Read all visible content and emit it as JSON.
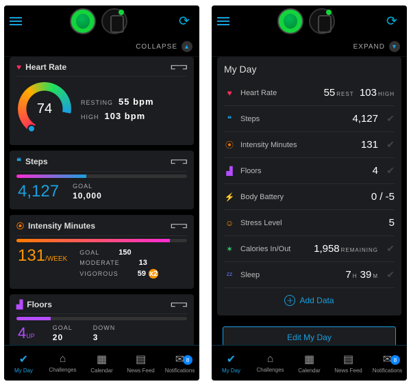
{
  "left": {
    "collapse_label": "COLLAPSE",
    "heart": {
      "title": "Heart Rate",
      "value": "74",
      "resting_label": "RESTING",
      "resting_value": "55 bpm",
      "high_label": "HIGH",
      "high_value": "103 bpm"
    },
    "steps": {
      "title": "Steps",
      "value": "4,127",
      "goal_label": "GOAL",
      "goal_value": "10,000"
    },
    "intensity": {
      "title": "Intensity Minutes",
      "value": "131",
      "unit": "/WEEK",
      "goal_label": "GOAL",
      "goal_value": "150",
      "moderate_label": "MODERATE",
      "moderate_value": "13",
      "vigorous_label": "VIGOROUS",
      "vigorous_value": "59",
      "vigorous_multi": "x2"
    },
    "floors": {
      "title": "Floors",
      "value": "4",
      "unit": "UP",
      "goal_label": "GOAL",
      "goal_value": "20",
      "down_label": "DOWN",
      "down_value": "3"
    }
  },
  "right": {
    "expand_label": "EXPAND",
    "title": "My Day",
    "rows": {
      "hr": {
        "label": "Heart Rate",
        "v1": "55",
        "u1": "REST",
        "v2": "103",
        "u2": "HIGH"
      },
      "steps": {
        "label": "Steps",
        "value": "4,127"
      },
      "intensity": {
        "label": "Intensity Minutes",
        "value": "131"
      },
      "floors": {
        "label": "Floors",
        "value": "4"
      },
      "body": {
        "label": "Body Battery",
        "value": "0 / -5"
      },
      "stress": {
        "label": "Stress Level",
        "value": "5"
      },
      "calories": {
        "label": "Calories In/Out",
        "value": "1,958",
        "sub": "REMAINING"
      },
      "sleep": {
        "label": "Sleep",
        "h": "7",
        "hU": "H",
        "m": "39",
        "mU": "M"
      }
    },
    "add_data": "Add Data",
    "edit": "Edit My Day"
  },
  "nav": {
    "myday": "My Day",
    "challenges": "Challenges",
    "calendar": "Calendar",
    "newsfeed": "News Feed",
    "notifications": "Notifications",
    "badge": "8"
  }
}
